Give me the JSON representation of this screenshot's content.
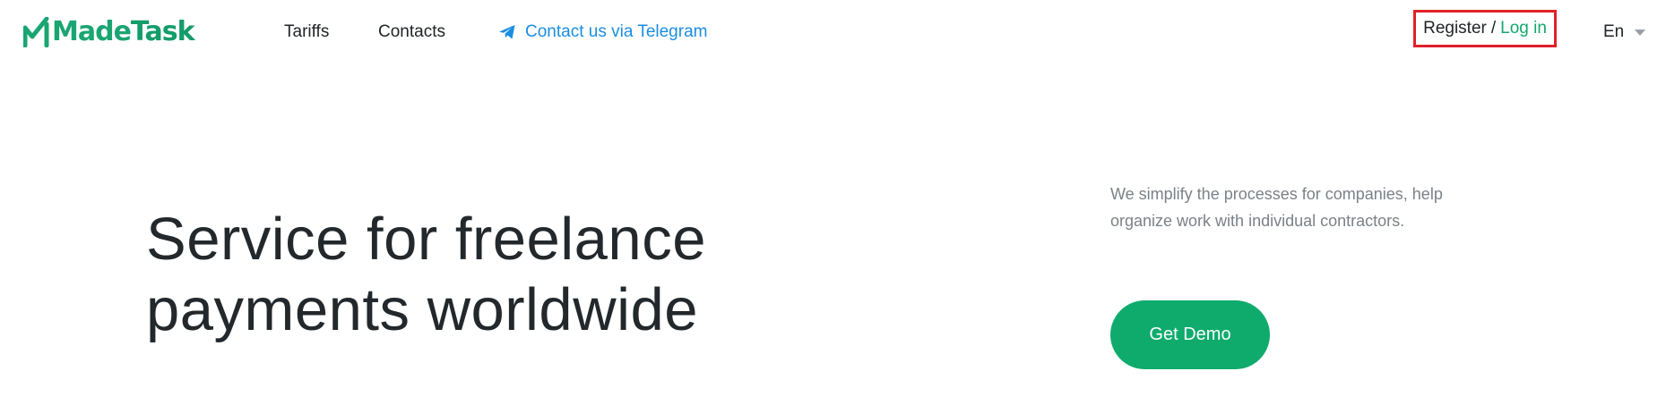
{
  "header": {
    "logo": {
      "made": "Made",
      "task": "Task",
      "brand_color": "#1aa572"
    },
    "nav": {
      "tariffs": "Tariffs",
      "contacts": "Contacts",
      "telegram": {
        "label": "Contact us via Telegram",
        "icon": "telegram-icon",
        "color": "#1a8ee0"
      }
    },
    "auth": {
      "register": "Register",
      "separator": "/",
      "login": "Log in",
      "highlight_color": "#e0212a"
    },
    "language": {
      "selected": "En"
    }
  },
  "hero": {
    "title": "Service for freelance\npayments worldwide",
    "description": "We simplify the processes for companies, help organize work with individual contractors.",
    "demo_button": "Get Demo",
    "accent_color": "#0eab6c"
  }
}
